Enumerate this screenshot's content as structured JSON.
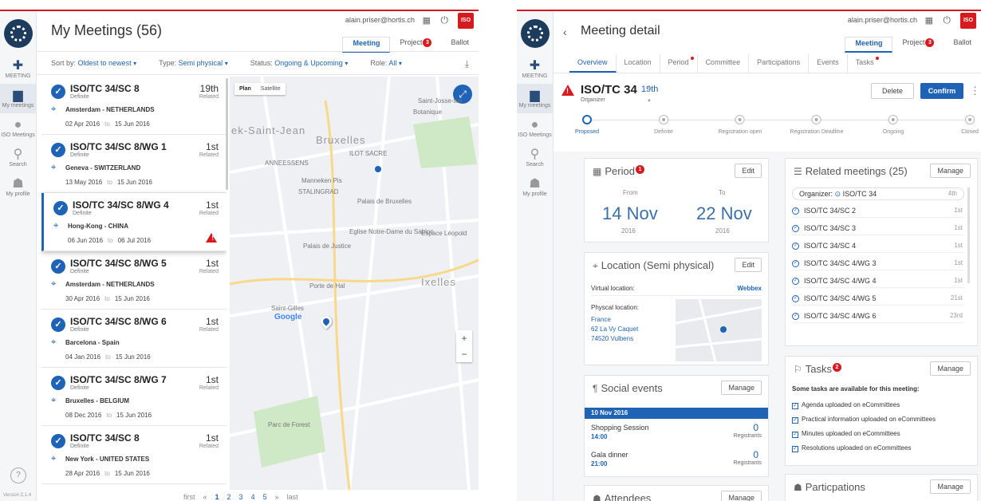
{
  "sidebar": {
    "items": [
      {
        "label": "MEETING",
        "icon": "plus-icon"
      },
      {
        "label": "My meetings",
        "icon": "briefcase-icon"
      },
      {
        "label": "ISO Meetings",
        "icon": "globe-icon"
      },
      {
        "label": "Search",
        "icon": "search-icon"
      },
      {
        "label": "My profile",
        "icon": "user-icon"
      }
    ],
    "help": "?",
    "version": "Version 2.1.4"
  },
  "header": {
    "email": "alain.priser@hortis.ch",
    "iso_logo": "ISO",
    "tabs": [
      {
        "label": "Meeting",
        "badge": ""
      },
      {
        "label": "Project",
        "badge": "3"
      },
      {
        "label": "Ballot",
        "badge": ""
      }
    ]
  },
  "list_page": {
    "title": "My Meetings (56)",
    "filters": [
      {
        "label": "Sort by:",
        "value": "Oldest to newest"
      },
      {
        "label": "Type:",
        "value": "Semi physical"
      },
      {
        "label": "Status:",
        "value": "Ongoing & Upcoming"
      },
      {
        "label": "Role:",
        "value": "All"
      }
    ],
    "meetings": [
      {
        "title": "ISO/TC 34/SC 8",
        "status": "Definite",
        "number": "19th",
        "related": "Related",
        "location": "Amsterdam - NETHERLANDS",
        "from": "02 Apr 2016",
        "to_word": "to",
        "to": "15 Jun 2016"
      },
      {
        "title": "ISO/TC 34/SC 8/WG 1",
        "status": "Definite",
        "number": "1st",
        "related": "Related",
        "location": "Geneva - SWITZERLAND",
        "from": "13 May 2016",
        "to_word": "to",
        "to": "15 Jun 2016"
      },
      {
        "title": "ISO/TC 34/SC 8/WG 4",
        "status": "Definite",
        "number": "1st",
        "related": "Related",
        "location": "Hong-Kong - CHINA",
        "from": "06 Jun 2016",
        "to_word": "to",
        "to": "06 Jul 2016"
      },
      {
        "title": "ISO/TC 34/SC 8/WG 5",
        "status": "Definite",
        "number": "1st",
        "related": "Related",
        "location": "Amsterdam - NETHERLANDS",
        "from": "30 Apr 2016",
        "to_word": "to",
        "to": "15 Jun 2016"
      },
      {
        "title": "ISO/TC 34/SC 8/WG 6",
        "status": "Definite",
        "number": "1st",
        "related": "Related",
        "location": "Barcelona - Spain",
        "from": "04 Jan 2016",
        "to_word": "to",
        "to": "15 Jun 2016"
      },
      {
        "title": "ISO/TC 34/SC 8/WG 7",
        "status": "Definite",
        "number": "1st",
        "related": "Related",
        "location": "Bruxelles - BELGIUM",
        "from": "08 Dec 2016",
        "to_word": "to",
        "to": "15 Jun 2016"
      },
      {
        "title": "ISO/TC 34/SC 8",
        "status": "Definite",
        "number": "1st",
        "related": "Related",
        "location": "New York - UNITED STATES",
        "from": "28 Apr 2016",
        "to_word": "to",
        "to": "15 Jun 2016"
      }
    ],
    "map": {
      "tabs": [
        "Plan",
        "Satellite"
      ],
      "labels": [
        "Bruxelles",
        "ILOT SACRE",
        "Manneken Pis",
        "STALINGRAD",
        "Palais de Bruxelles",
        "Eglise Notre-Dame du Sablon",
        "Palais de Justice",
        "Porte de Hal",
        "Saint-Gilles",
        "Ixelles",
        "Parc de Forest",
        "Botanique",
        "Espace Léopold",
        "ANNEESSENS",
        "ek-Saint-Jean",
        "Saint-Josse-ten",
        "Google"
      ]
    },
    "pagination": {
      "first": "first",
      "prev": "«",
      "pages": [
        "1",
        "2",
        "3",
        "4",
        "5"
      ],
      "next": "»",
      "last": "last"
    }
  },
  "detail_page": {
    "title": "Meeting detail",
    "tabs": [
      {
        "label": "Overview",
        "dot": false
      },
      {
        "label": "Location",
        "dot": false
      },
      {
        "label": "Period",
        "dot": true
      },
      {
        "label": "Committee",
        "dot": false
      },
      {
        "label": "Participations",
        "dot": false
      },
      {
        "label": "Events",
        "dot": false
      },
      {
        "label": "Tasks",
        "dot": true
      }
    ],
    "meeting": {
      "title": "ISO/TC 34",
      "number": "19th",
      "role": "Organizer"
    },
    "buttons": {
      "delete": "Delete",
      "confirm": "Confirm"
    },
    "steps": [
      "Proposed",
      "Definite",
      "Registration open",
      "Registration Deadline",
      "Ongoing",
      "Closed"
    ],
    "period": {
      "title": "Period",
      "badge": "1",
      "edit": "Edit",
      "from_label": "From",
      "to_label": "To",
      "from": "14 Nov",
      "to": "22 Nov",
      "from_year": "2016",
      "to_year": "2016"
    },
    "location": {
      "title": "Location (Semi physical)",
      "edit": "Edit",
      "virtual_label": "Virtual location:",
      "virtual_value": "Webbex",
      "physical_label": "Physcal location:",
      "address": [
        "France",
        "62 La Vy Caquet",
        "74520 Vulbens"
      ]
    },
    "social": {
      "title": "Social events",
      "manage": "Manage",
      "date": "10 Nov 2016",
      "events": [
        {
          "name": "Shopping Session",
          "time": "14:00",
          "count": "0",
          "registrants": "Registrants"
        },
        {
          "name": "Gala dinner",
          "time": "21:00",
          "count": "0",
          "registrants": "Registrants"
        }
      ]
    },
    "attendees": {
      "title": "Attendees",
      "manage": "Manage"
    },
    "related": {
      "title": "Related meetings (25)",
      "manage": "Manage",
      "organizer_label": "Organizer:",
      "organizer": "ISO/TC 34",
      "organizer_num": "4th",
      "items": [
        {
          "name": "ISO/TC 34/SC 2",
          "num": "1st"
        },
        {
          "name": "ISO/TC 34/SC 3",
          "num": "1st"
        },
        {
          "name": "ISO/TC 34/SC 4",
          "num": "1st"
        },
        {
          "name": "ISO/TC 34/SC 4/WG 3",
          "num": "1st"
        },
        {
          "name": "ISO/TC 34/SC 4/WG 4",
          "num": "1st"
        },
        {
          "name": "ISO/TC 34/SC 4/WG 5",
          "num": "21st"
        },
        {
          "name": "ISO/TC 34/SC 4/WG 6",
          "num": "23rd"
        }
      ]
    },
    "tasks": {
      "title": "Tasks",
      "badge": "2",
      "manage": "Manage",
      "intro": "Some tasks are available for this meeting:",
      "items": [
        "Agenda uploaded on eCommittees",
        "Practical information uploaded on eCommittees",
        "Minutes uploaded on eCommittees",
        "Resolutions uploaded on eCommittees"
      ]
    },
    "participations": {
      "title": "Particpations",
      "manage": "Manage"
    }
  }
}
